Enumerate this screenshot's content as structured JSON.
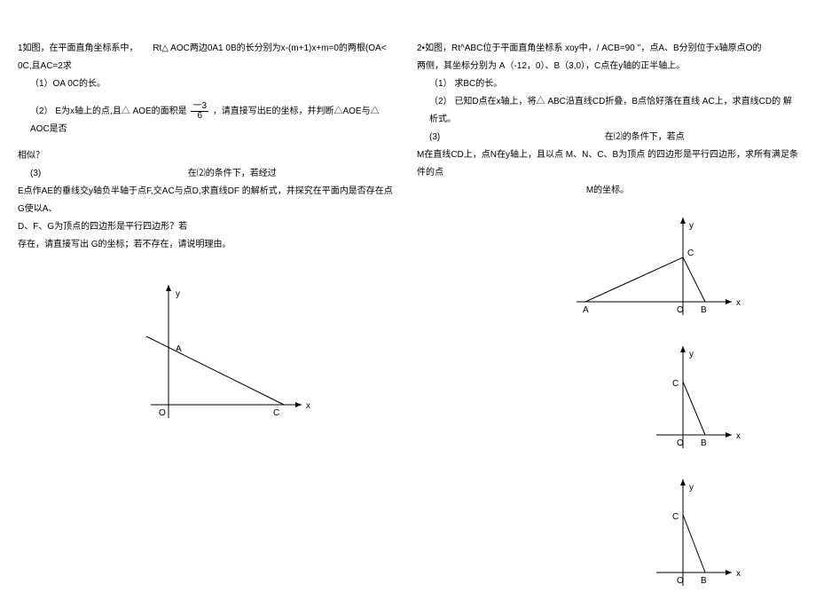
{
  "left": {
    "p1_intro": "1如图，在平面直角坐标系中，",
    "p1_mid": "Rt△ AOC两边0A1 0B的长分别为x-(m+1)x+m=0的两根(OA<",
    "p1_end": "0C,且AC=2求",
    "q1b_pre": "（2） E为x轴上的点,且△ AOE的面积是",
    "q1b_post": "，请直接写出E的坐标，并判断△AOE与△ AOC是否",
    "q1b_similar": "相似？",
    "frac_num": "一3",
    "frac_den": "6",
    "q1a": "（1）OA 0C的长。",
    "q1c_label": "(3)",
    "q1c_text": "在⑵的条件下，若经过",
    "q1c_line1": "E点作AE的垂线交y轴负半轴于点F,交AC与点D,求直线DF 的解析式，并探究在平面内是否存在点 G使以A、",
    "q1c_line2": "D、F、G为顶点的四边形是平行四边形？若",
    "q1c_line3": "存在，请直接写出 G的坐标；若不存在，请说明理由。"
  },
  "right": {
    "p2_intro": "2•如图，Rt^ABC位于平面直角坐标系 xoy中，/ ACB=90 ''，点A、B分别位于x轴原点O的",
    "p2_line2": "两侧，其坐标分别为 A（-12，0）、B（3,0），C点在y轴的正半轴上。",
    "q2a": "（1） 求BC的长。",
    "q2b": "（2） 已知D点在x轴上，将△ ABC沿直线CD折叠，B点恰好落在直线 AC上，求直线CD的 解析式。",
    "q2c_label": "(3)",
    "q2c_text": "在⑵的条件下，若点",
    "q2c_line1": "M在直线CD上，点N在y轴上，且以点 M、N、C、B为顶点 的四边形是平行四边形，求所有满足条件的点",
    "q2c_line2": "M的坐标。"
  },
  "chart_data": {
    "left_figure": {
      "type": "line",
      "title": "",
      "xlabel": "x",
      "ylabel": "y",
      "points": {
        "O": [
          0,
          0
        ],
        "A": [
          0,
          1
        ],
        "C": [
          2,
          0
        ]
      },
      "line_segment": "Line through A and C extended",
      "axes_labels": [
        "O",
        "A",
        "C",
        "x",
        "y"
      ]
    },
    "right_figure_1": {
      "type": "line",
      "title": "",
      "xlabel": "x",
      "ylabel": "y",
      "points": {
        "A": [
          -12,
          0
        ],
        "O": [
          0,
          0
        ],
        "B": [
          3,
          0
        ],
        "C": [
          0,
          6
        ]
      },
      "line_segments": [
        "A-C",
        "C-B"
      ],
      "axes_labels": [
        "A",
        "O",
        "B",
        "C",
        "x",
        "y"
      ]
    },
    "right_figure_2": {
      "type": "line",
      "title": "",
      "xlabel": "x",
      "ylabel": "y",
      "points": {
        "O": [
          0,
          0
        ],
        "B": [
          3,
          0
        ],
        "C": [
          0,
          6
        ]
      },
      "line_segments": [
        "C-B"
      ],
      "axes_labels": [
        "O",
        "B",
        "C",
        "x",
        "y"
      ]
    },
    "right_figure_3": {
      "type": "line",
      "title": "",
      "xlabel": "x",
      "ylabel": "y",
      "points": {
        "O": [
          0,
          0
        ],
        "B": [
          3,
          0
        ],
        "C": [
          0,
          6
        ]
      },
      "line_segments": [
        "C-B"
      ],
      "axes_labels": [
        "O",
        "B",
        "C",
        "x",
        "y"
      ]
    }
  }
}
